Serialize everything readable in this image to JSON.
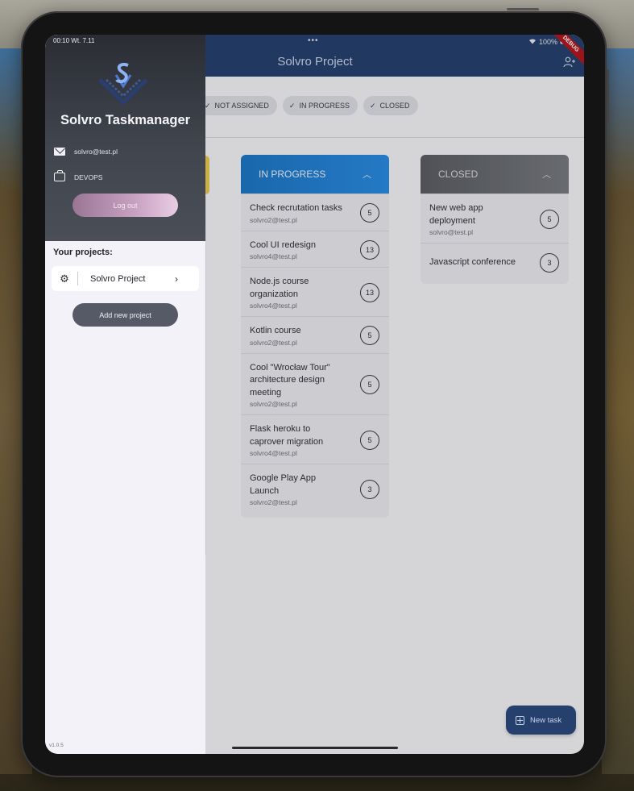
{
  "status": {
    "time": "00:10",
    "date": "Wt. 7.11",
    "battery": "100%"
  },
  "appbar": {
    "title": "Solvro Project",
    "debug_badge": "DEBUG"
  },
  "filters": [
    {
      "label": "NOT ASSIGNED",
      "checked": true
    },
    {
      "label": "IN PROGRESS",
      "checked": true
    },
    {
      "label": "CLOSED",
      "checked": true
    }
  ],
  "columns": {
    "in_progress": {
      "title": "IN PROGRESS",
      "color": "#1c76c5",
      "tasks": [
        {
          "title": "Check recrutation tasks",
          "email": "solvro2@test.pl",
          "points": "5"
        },
        {
          "title": "Cool UI redesign",
          "email": "solvro4@test.pl",
          "points": "13"
        },
        {
          "title": "Node.js course organization",
          "email": "solvro4@test.pl",
          "points": "13"
        },
        {
          "title": "Kotlin course",
          "email": "solvro2@test.pl",
          "points": "5"
        },
        {
          "title": "Cool \"Wrocław Tour\" architecture design meeting",
          "email": "solvro2@test.pl",
          "points": "5"
        },
        {
          "title": "Flask heroku to caprover migration",
          "email": "solvro4@test.pl",
          "points": "5"
        },
        {
          "title": "Google Play App Launch",
          "email": "solvro2@test.pl",
          "points": "3"
        }
      ]
    },
    "closed": {
      "title": "CLOSED",
      "color": "#5b5d63",
      "tasks": [
        {
          "title": "New web app deployment",
          "email": "solvro@test.pl",
          "points": "5"
        },
        {
          "title": "Javascript conference",
          "email": "",
          "points": "3"
        }
      ]
    }
  },
  "fab": {
    "label": "New task"
  },
  "drawer": {
    "app_name": "Solvro Taskmanager",
    "email": "solvro@test.pl",
    "role": "DEVOPS",
    "logout_label": "Log out",
    "projects_label": "Your projects:",
    "projects": [
      {
        "name": "Solvro Project"
      }
    ],
    "add_project_label": "Add new project",
    "version": "v1.0.5"
  },
  "icons": {
    "mail": "mail-icon",
    "briefcase": "briefcase-icon",
    "gear": "gear-icon",
    "chevron": "chevron-right-icon",
    "check": "check-icon",
    "add_user": "add-user-icon",
    "wifi": "wifi-icon",
    "battery": "battery-icon",
    "new_task": "add-box-icon"
  }
}
